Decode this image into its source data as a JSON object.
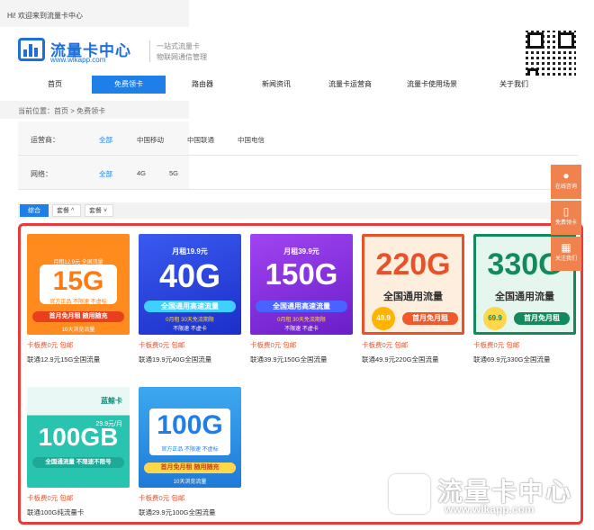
{
  "header": {
    "greeting": "Hi! 欢迎来到流量卡中心",
    "logo_name": "流量卡中心",
    "logo_url": "www.wlkapp.com",
    "slogan_line1": "一站式流量卡",
    "slogan_line2": "物联网通信管理"
  },
  "nav": {
    "items": [
      {
        "label": "首页"
      },
      {
        "label": "免费领卡"
      },
      {
        "label": "路由器"
      },
      {
        "label": "新闻资讯"
      },
      {
        "label": "流量卡运营商"
      },
      {
        "label": "流量卡使用场景"
      },
      {
        "label": "关于我们"
      }
    ],
    "active_index": 1
  },
  "breadcrumb": "当前位置：首页 > 免费领卡",
  "filters": {
    "operator": {
      "label": "运营商：",
      "options": [
        "全部",
        "中国移动",
        "中国联通",
        "中国电信"
      ],
      "selected": "全部"
    },
    "network": {
      "label": "网络：",
      "options": [
        "全部",
        "4G",
        "5G"
      ],
      "selected": "全部"
    }
  },
  "sort": {
    "options": [
      {
        "label": "综合"
      },
      {
        "label": "套餐 ^"
      },
      {
        "label": "套餐 ˅"
      }
    ]
  },
  "side_widgets": [
    {
      "label": "在线咨询",
      "icon": "chat-icon"
    },
    {
      "label": "免费领卡",
      "icon": "phone-icon"
    },
    {
      "label": "关注我们",
      "icon": "qrcode-icon"
    }
  ],
  "products": [
    {
      "price": "卡板费0元 包邮",
      "name": "联通12.9元15G全国流量",
      "art_main": "15G",
      "art_top": "月租12.9元 全国流量",
      "art_sub1": "官方正品 不限速 不虚标",
      "art_band": "首月免月租 随用随充",
      "art_sub2": "10天浏览流量",
      "colors": {
        "bg": "#ff8a1e",
        "accent": "#ffffff"
      }
    },
    {
      "price": "卡板费0元 包邮",
      "name": "联通19.9元40G全国流量",
      "art_main": "40G",
      "art_top": "月租19.9元",
      "art_band": "全国通用高速流量",
      "art_sub1": "0月租 30天免流期限",
      "art_sub2": "不限速 不虚卡",
      "colors": {
        "bg": "#2a48e8",
        "accent": "#ffffff"
      }
    },
    {
      "price": "卡板费0元 包邮",
      "name": "联通39.9元150G全国流量",
      "art_main": "150G",
      "art_top": "月租39.9元",
      "art_band": "全国通用高速流量",
      "art_sub1": "0月租 30天免流期限",
      "art_sub2": "不限速 不虚卡",
      "colors": {
        "bg": "#8a2fe0",
        "accent": "#ffffff"
      }
    },
    {
      "price": "卡板费0元 包邮",
      "name": "联通49.9元220G全国流量",
      "art_main": "220G",
      "art_top": "",
      "art_band": "全国通用流量",
      "art_sub1": "49.9",
      "art_sub2": "首月免月租",
      "colors": {
        "bg": "#fdeede",
        "accent": "#e8522a"
      }
    },
    {
      "price": "卡板费0元 包邮",
      "name": "联通69.9元330G全国流量",
      "art_main": "330G",
      "art_top": "",
      "art_band": "全国通用流量",
      "art_sub1": "69.9",
      "art_sub2": "首月免月租",
      "colors": {
        "bg": "#e5f6ee",
        "accent": "#128a5e"
      }
    },
    {
      "price": "卡板费0元 包邮",
      "name": "联通100G纯流量卡",
      "art_main": "100GB",
      "art_top": "29.9元/月",
      "art_band": "全国通流量 不限速不限号",
      "art_sub1": "蓝鲸卡",
      "art_sub2": "",
      "colors": {
        "bg": "#28c4b0",
        "accent": "#ffffff"
      }
    },
    {
      "price": "卡板费0元 包邮",
      "name": "联通29.9元100G全国流量",
      "art_main": "100G",
      "art_top": "",
      "art_band": "首月免月租 随用随充",
      "art_sub1": "官方正品 不限速 不虚标",
      "art_sub2": "10天浏览流量",
      "colors": {
        "bg": "#3da8f0",
        "accent": "#ffffff"
      }
    }
  ],
  "watermark": {
    "name": "流量卡中心",
    "url": "www.wlkapp.com"
  },
  "colors": {
    "primary": "#1e7fe8",
    "price": "#e8542e",
    "highlight_border": "#e83a3a",
    "side_widget": "#f0824e"
  }
}
